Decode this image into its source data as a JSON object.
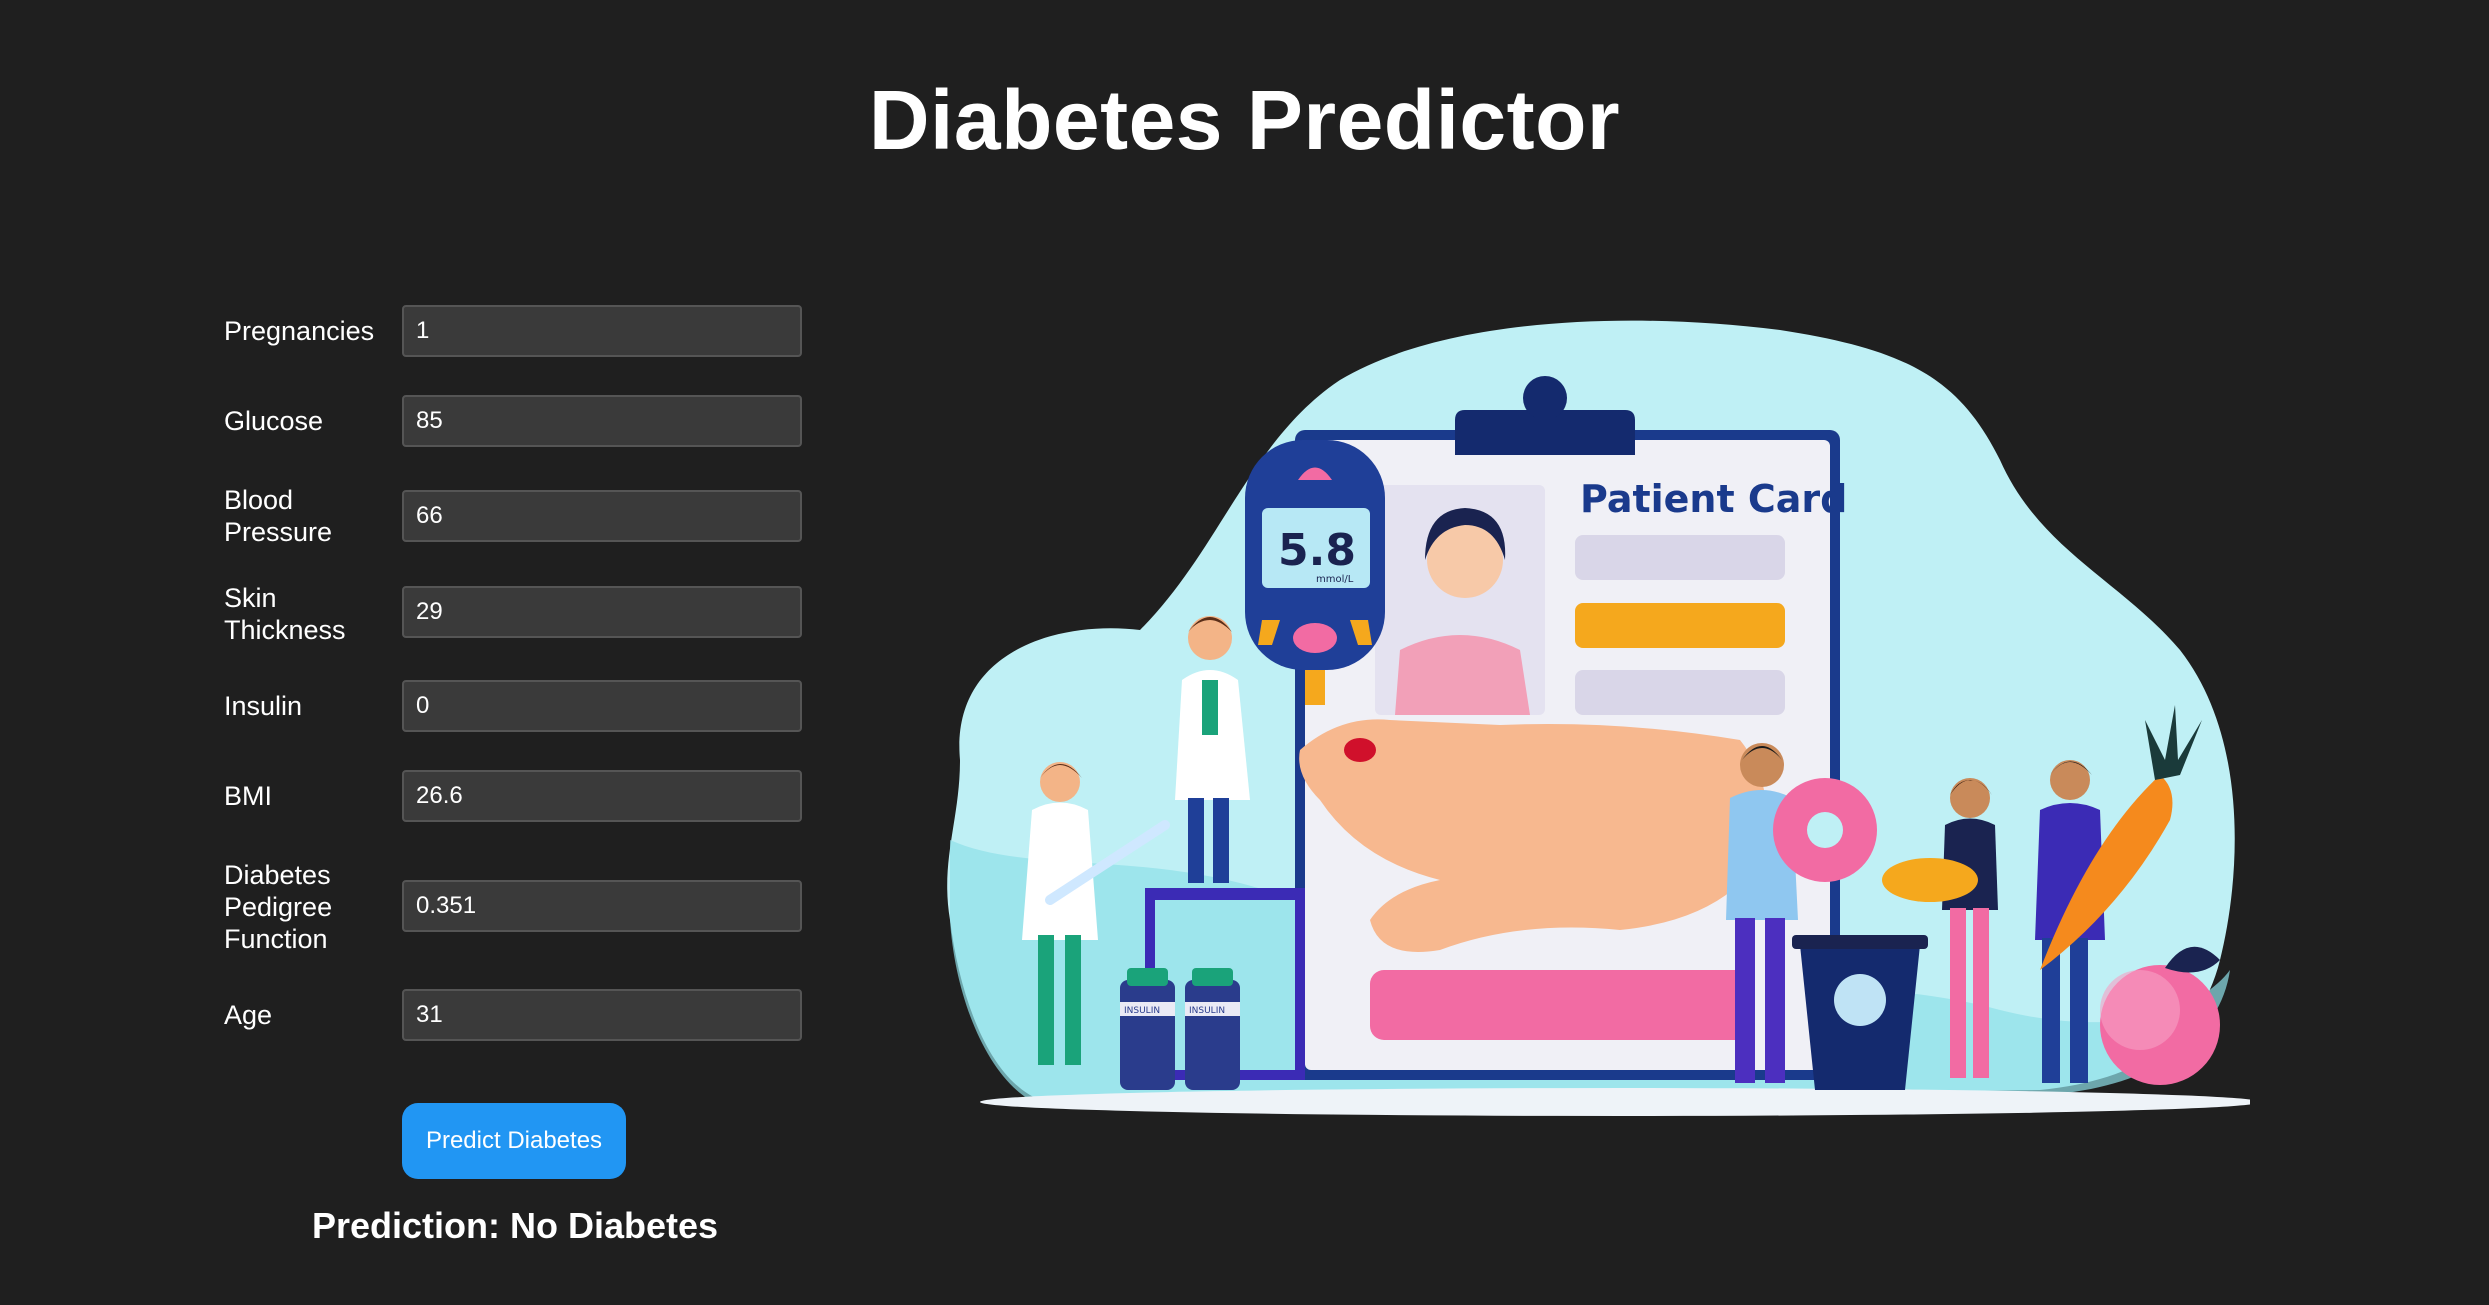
{
  "header": {
    "title": "Diabetes Predictor"
  },
  "form": {
    "fields": [
      {
        "label": "Pregnancies",
        "value": "1"
      },
      {
        "label": "Glucose",
        "value": "85"
      },
      {
        "label": "Blood Pressure",
        "value": "66"
      },
      {
        "label": "Skin Thickness",
        "value": "29"
      },
      {
        "label": "Insulin",
        "value": "0"
      },
      {
        "label": "BMI",
        "value": "26.6"
      },
      {
        "label": "Diabetes Pedigree Function",
        "value": "0.351"
      },
      {
        "label": "Age",
        "value": "31"
      }
    ],
    "submit_label": "Predict Diabetes"
  },
  "result": {
    "text": "Prediction: No Diabetes"
  },
  "illustration": {
    "card_title": "Patient Card",
    "meter_reading": "5.8",
    "meter_unit": "mmol/L",
    "vial_label": "INSULIN"
  },
  "colors": {
    "background": "#1f1f1f",
    "input_bg": "#3a3a3a",
    "button": "#2196f3",
    "blob": "#bff0f5",
    "card_frame": "#1a3a8c",
    "accent_orange": "#f5a81d",
    "accent_pink": "#f26ba3"
  }
}
